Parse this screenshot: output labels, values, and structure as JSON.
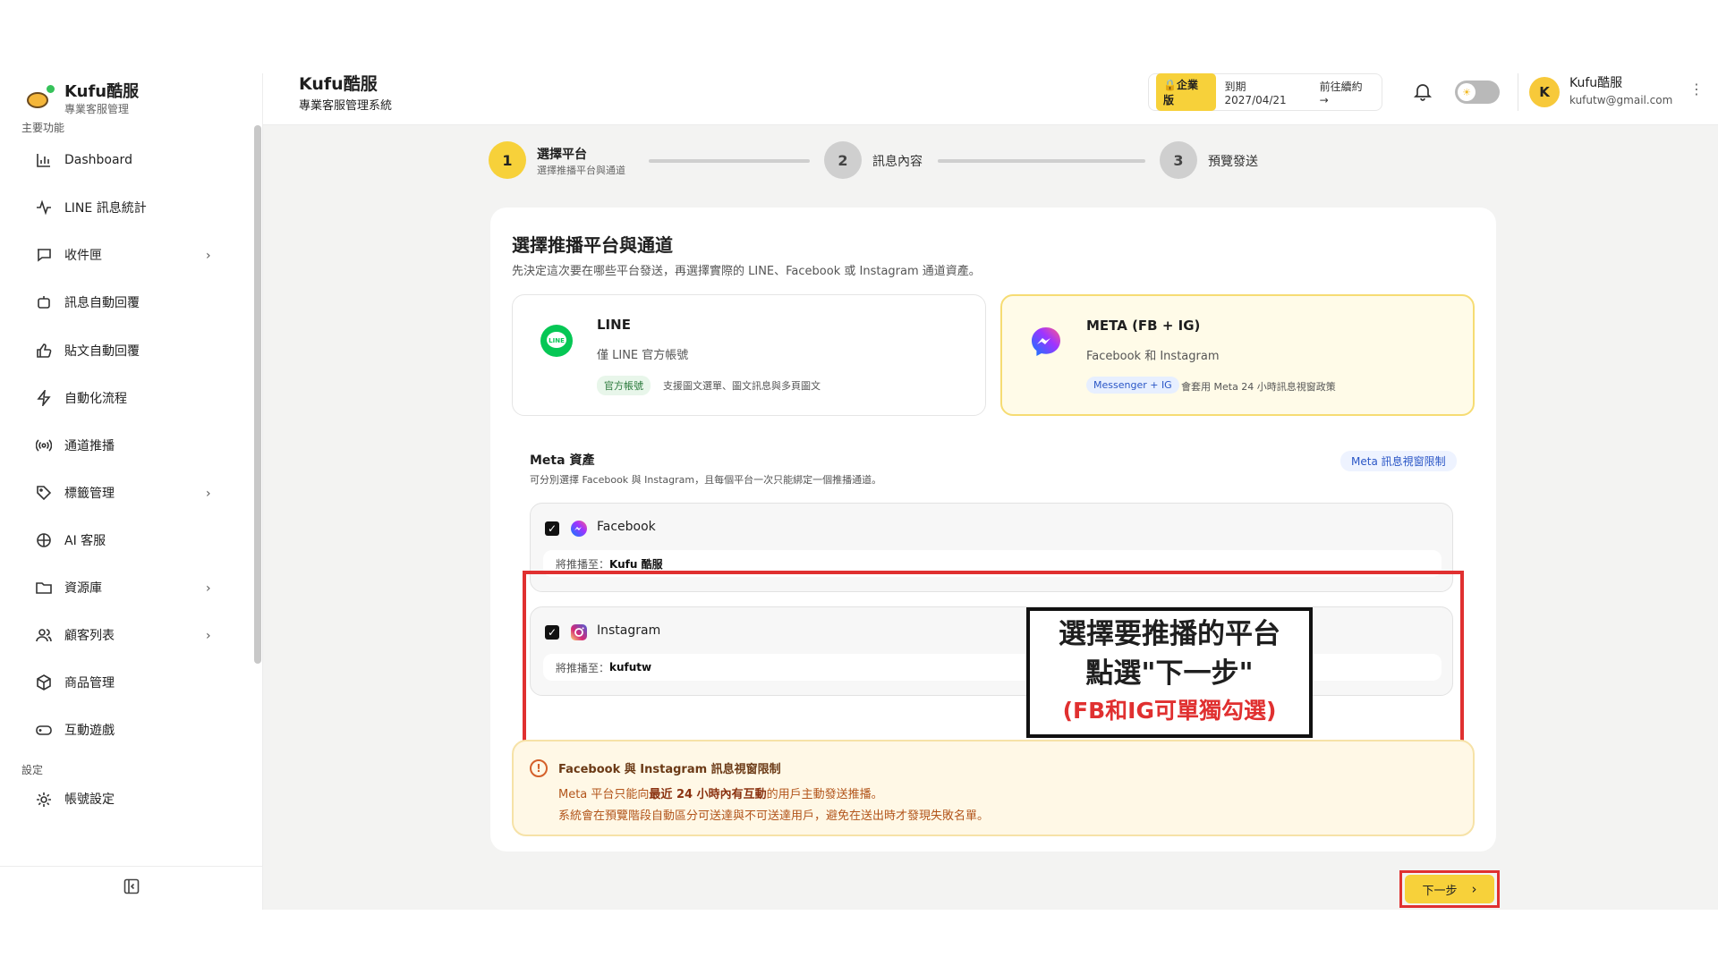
{
  "brand": {
    "name": "Kufu酷服",
    "tagline": "專業客服管理"
  },
  "header": {
    "title": "Kufu酷服",
    "subtitle": "專業客服管理系統",
    "plan_badge": "企業版",
    "plan_expiry": "到期 2027/04/21",
    "plan_renew": "前往續約 →",
    "user_initial": "K",
    "user_name": "Kufu酷服",
    "user_email": "kufutw@gmail.com"
  },
  "sidebar": {
    "section_main": "主要功能",
    "section_settings": "設定",
    "items": [
      {
        "label": "Dashboard",
        "icon": "bar-chart-icon",
        "chevron": false
      },
      {
        "label": "LINE 訊息統計",
        "icon": "activity-icon",
        "chevron": false
      },
      {
        "label": "收件匣",
        "icon": "chat-icon",
        "chevron": true
      },
      {
        "label": "訊息自動回覆",
        "icon": "bot-icon",
        "chevron": false
      },
      {
        "label": "貼文自動回覆",
        "icon": "thumbs-up-icon",
        "chevron": false
      },
      {
        "label": "自動化流程",
        "icon": "lightning-icon",
        "chevron": false
      },
      {
        "label": "通道推播",
        "icon": "broadcast-icon",
        "chevron": false
      },
      {
        "label": "標籤管理",
        "icon": "tag-icon",
        "chevron": true
      },
      {
        "label": "AI 客服",
        "icon": "ai-icon",
        "chevron": false
      },
      {
        "label": "資源庫",
        "icon": "folder-icon",
        "chevron": true
      },
      {
        "label": "顧客列表",
        "icon": "users-icon",
        "chevron": true
      },
      {
        "label": "商品管理",
        "icon": "box-icon",
        "chevron": false
      },
      {
        "label": "互動遊戲",
        "icon": "gamepad-icon",
        "chevron": false
      }
    ],
    "settings_items": [
      {
        "label": "帳號設定",
        "icon": "gear-icon"
      }
    ]
  },
  "stepper": {
    "steps": [
      {
        "number": "1",
        "label": "選擇平台",
        "sub": "選擇推播平台與通道",
        "active": true
      },
      {
        "number": "2",
        "label": "訊息內容",
        "sub": "",
        "active": false
      },
      {
        "number": "3",
        "label": "預覽發送",
        "sub": "",
        "active": false
      }
    ]
  },
  "card": {
    "title": "選擇推播平台與通道",
    "description": "先決定這次要在哪些平台發送，再選擇實際的 LINE、Facebook 或 Instagram 通道資產。",
    "platforms": [
      {
        "name": "LINE",
        "desc": "僅 LINE 官方帳號",
        "tag": "官方帳號",
        "note": "支援圖文選單、圖文訊息與多頁圖文",
        "selected": false
      },
      {
        "name": "META (FB + IG)",
        "desc": "Facebook 和 Instagram",
        "tag": "Messenger + IG",
        "note": "會套用 Meta 24 小時訊息視窗政策",
        "selected": true
      }
    ],
    "meta_title": "Meta 資產",
    "meta_desc": "可分別選擇 Facebook 與 Instagram，且每個平台一次只能綁定一個推播通道。",
    "meta_link": "Meta 訊息視窗限制",
    "assets": [
      {
        "name": "Facebook",
        "target_label": "將推播至：",
        "target": "Kufu 酷服",
        "checked": true
      },
      {
        "name": "Instagram",
        "target_label": "將推播至：",
        "target": "kufutw",
        "checked": true
      }
    ],
    "warning": {
      "title": "Facebook 與 Instagram 訊息視窗限制",
      "line1_pre": "Meta 平台只能向",
      "line1_bold": "最近 24 小時內有互動",
      "line1_post": "的用戶主動發送推播。",
      "line2": "系統會在預覽階段自動區分可送達與不可送達用戶，避免在送出時才發現失敗名單。"
    }
  },
  "annotation": {
    "line1": "選擇要推播的平台",
    "line2": "點選\"下一步\"",
    "line3": "(FB和IG可單獨勾選)"
  },
  "next_button": {
    "label": "下一步"
  },
  "colors": {
    "accent": "#f7d13a",
    "highlight": "#e03030",
    "meta_selected_bg": "#fffbe8"
  }
}
